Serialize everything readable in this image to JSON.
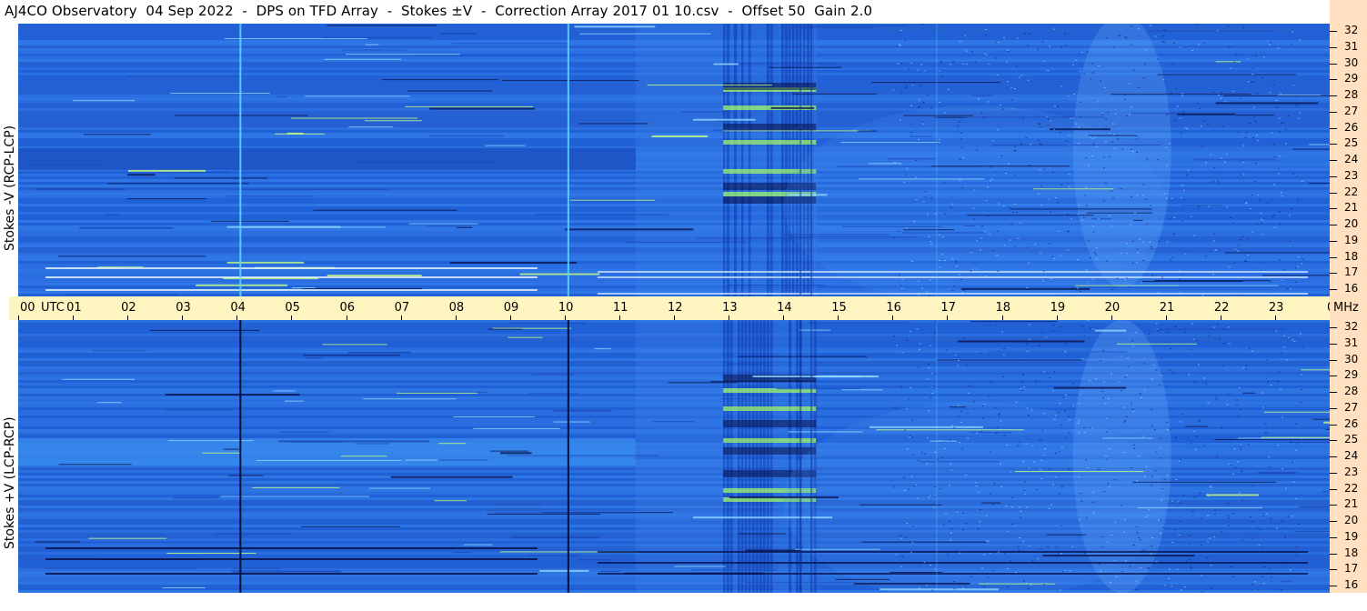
{
  "title": "AJ4CO Observatory  04 Sep 2022  -  DPS on TFD Array  -  Stokes ±V  -  Correction Array 2017 01 10.csv  -  Offset 50  Gain 2.0",
  "chart_data": [
    {
      "type": "heatmap",
      "name": "top-panel",
      "ylabel": "Stokes -V (RCP-LCP)",
      "x_unit": "UTC",
      "x_ticks": [
        "00",
        "01",
        "02",
        "03",
        "04",
        "05",
        "06",
        "07",
        "08",
        "09",
        "10",
        "11",
        "12",
        "13",
        "14",
        "15",
        "16",
        "17",
        "18",
        "19",
        "20",
        "21",
        "22",
        "23",
        "00"
      ],
      "y_ticks": [
        16,
        17,
        18,
        19,
        20,
        21,
        22,
        23,
        24,
        25,
        26,
        27,
        28,
        29,
        30,
        31,
        32
      ],
      "y_unit": "MHz",
      "xlim": [
        0,
        24
      ],
      "ylim": [
        16,
        32
      ],
      "colors": {
        "background": "#2a6ee0",
        "quiet": "#1c54c8",
        "bright": "#a8ff60",
        "dark": "#08104a"
      }
    },
    {
      "type": "heatmap",
      "name": "bottom-panel",
      "ylabel": "Stokes +V (LCP-RCP)",
      "x_unit": "UTC",
      "x_ticks": [
        "00",
        "01",
        "02",
        "03",
        "04",
        "05",
        "06",
        "07",
        "08",
        "09",
        "10",
        "11",
        "12",
        "13",
        "14",
        "15",
        "16",
        "17",
        "18",
        "19",
        "20",
        "21",
        "22",
        "23",
        "00"
      ],
      "y_ticks": [
        16,
        17,
        18,
        19,
        20,
        21,
        22,
        23,
        24,
        25,
        26,
        27,
        28,
        29,
        30,
        31,
        32
      ],
      "y_unit": "MHz",
      "xlim": [
        0,
        24
      ],
      "ylim": [
        16,
        32
      ],
      "colors": {
        "background": "#2a66d8",
        "quiet": "#1c54c8",
        "bright": "#a8ff60",
        "dark": "#08104a"
      }
    }
  ],
  "axis": {
    "utc_label": "UTC",
    "mhz_label": "MHz"
  }
}
